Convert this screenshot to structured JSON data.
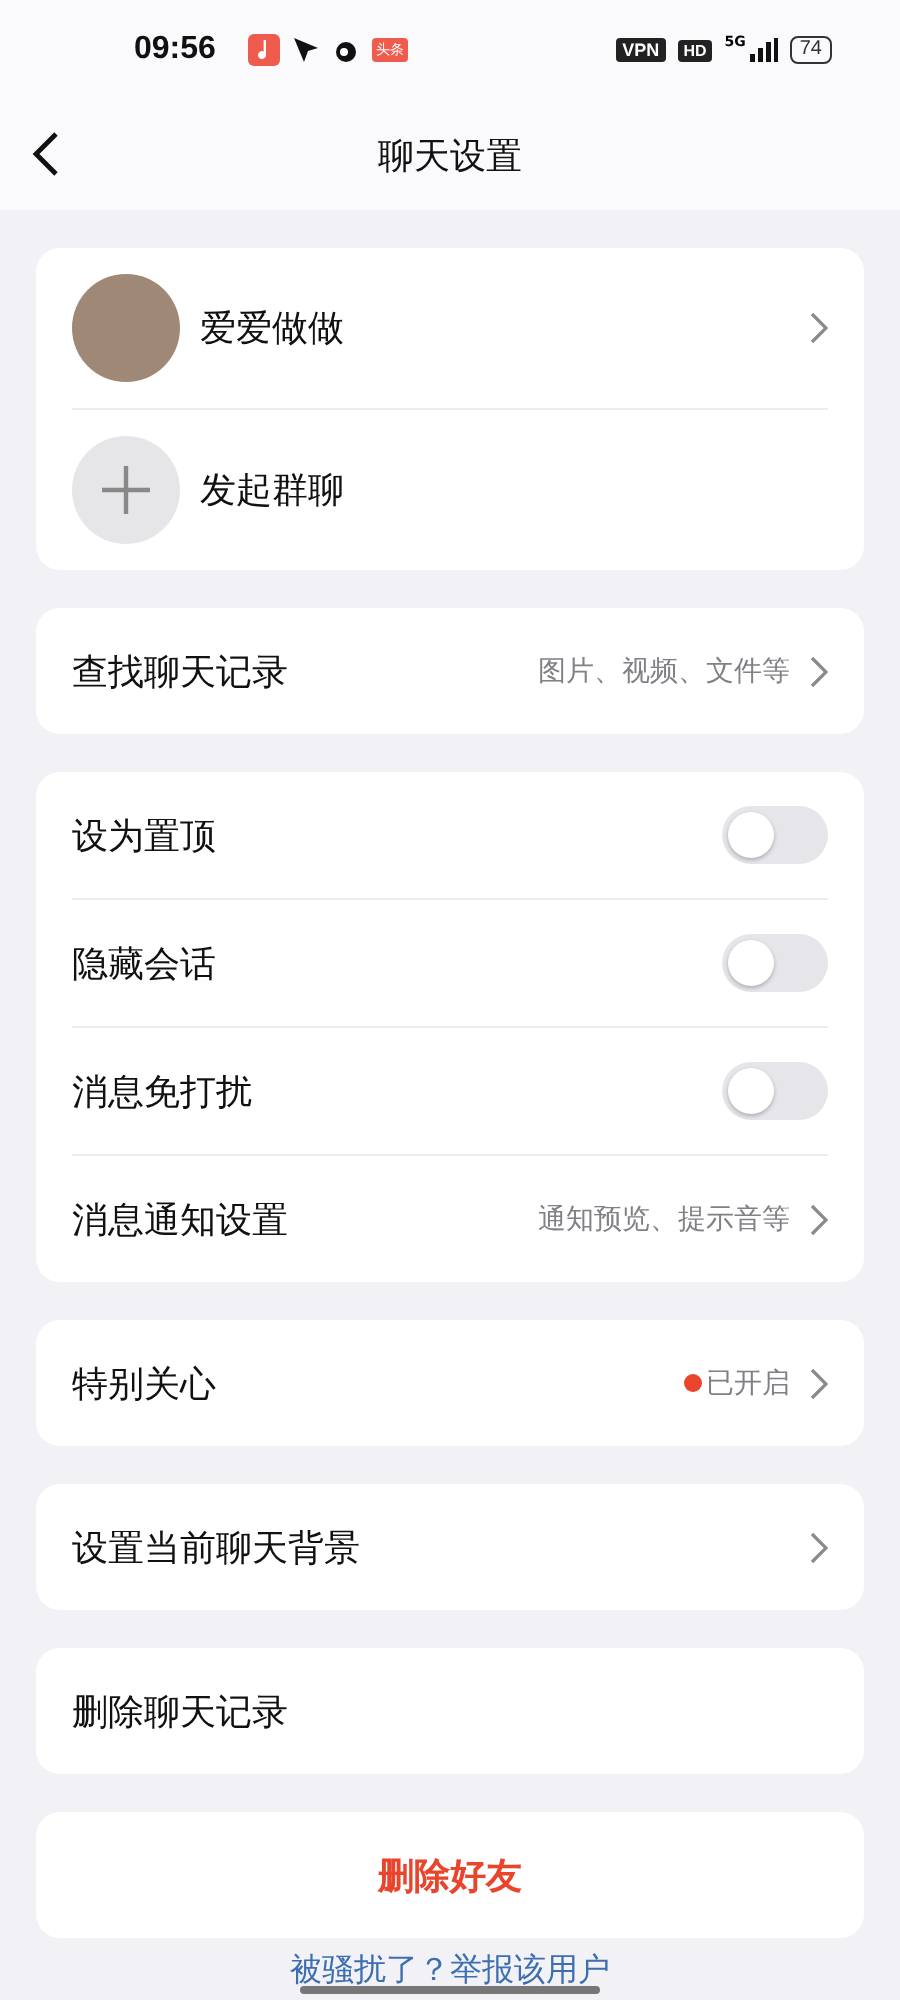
{
  "status_bar": {
    "time": "09:56",
    "app_badge": "头条",
    "vpn": "VPN",
    "hd": "HD",
    "network": "5G",
    "battery": "74"
  },
  "header": {
    "title": "聊天设置"
  },
  "members": [
    {
      "kind": "contact",
      "label": "爱爱做做"
    },
    {
      "kind": "add",
      "label": "发起群聊"
    }
  ],
  "sections": [
    {
      "rows": [
        {
          "kind": "link",
          "label": "查找聊天记录",
          "value": "图片、视频、文件等",
          "dot": false
        }
      ]
    },
    {
      "rows": [
        {
          "kind": "toggle",
          "label": "设为置顶",
          "on": false
        },
        {
          "kind": "toggle",
          "label": "隐藏会话",
          "on": false
        },
        {
          "kind": "toggle",
          "label": "消息免打扰",
          "on": false
        },
        {
          "kind": "link",
          "label": "消息通知设置",
          "value": "通知预览、提示音等",
          "dot": false
        }
      ]
    },
    {
      "rows": [
        {
          "kind": "link",
          "label": "特别关心",
          "value": "已开启",
          "dot": true
        }
      ]
    },
    {
      "rows": [
        {
          "kind": "link",
          "label": "设置当前聊天背景",
          "dot": false
        }
      ]
    },
    {
      "rows": [
        {
          "kind": "action",
          "label": "删除聊天记录"
        }
      ]
    },
    {
      "rows": [
        {
          "kind": "danger",
          "label": "删除好友"
        }
      ]
    }
  ],
  "report_link": "被骚扰了？举报该用户"
}
